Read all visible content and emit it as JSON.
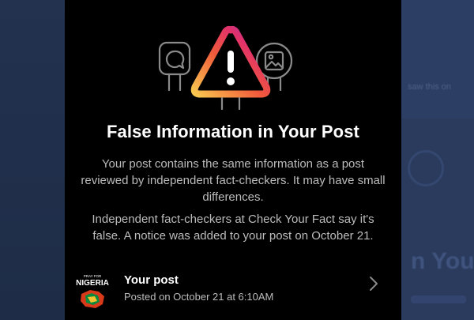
{
  "background": {
    "blurred_text": "saw this on",
    "blurred_heading": "n Your F"
  },
  "dialog": {
    "title": "False Information in Your Post",
    "paragraph_1": "Your post contains the same information as a post reviewed by independent fact-checkers. It may have small differences.",
    "paragraph_2": "Independent fact-checkers at Check Your Fact say it's false.  A notice was added to your post on October 21."
  },
  "post": {
    "title": "Your post",
    "subtitle": "Posted on October 21 at 6:10AM",
    "thumbnail_text_small": "PRAY FOR",
    "thumbnail_text_main": "NIGERIA"
  },
  "colors": {
    "sheet": "#000000",
    "gradient_start": "#f9c74f",
    "gradient_mid": "#e1306c",
    "gradient_end": "#7b2ff7",
    "nigeria_green": "#0b8a3e",
    "text_secondary": "#bcbcbc"
  },
  "icons": {
    "warning": "warning-triangle-icon",
    "chat_sign": "chat-bubble-sign-icon",
    "image_sign": "image-sign-icon",
    "chevron": "chevron-right-icon"
  }
}
